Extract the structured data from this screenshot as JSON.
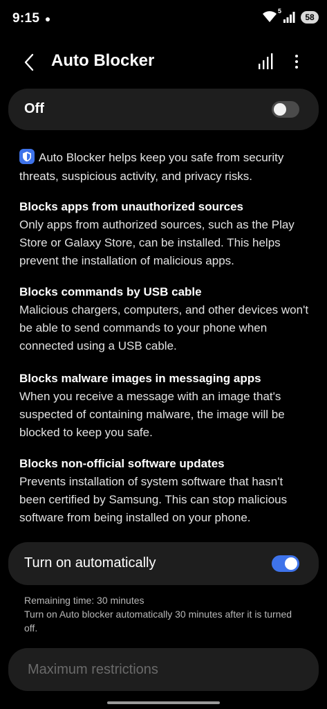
{
  "status_bar": {
    "time": "9:15",
    "wifi_badge": "5",
    "battery": "58"
  },
  "app_bar": {
    "title": "Auto Blocker"
  },
  "main_toggle": {
    "label": "Off",
    "enabled": false
  },
  "intro_text": "Auto Blocker helps keep you safe from security threats, suspicious activity, and privacy risks.",
  "sections": [
    {
      "title": "Blocks apps from unauthorized sources",
      "description": "Only apps from authorized sources, such as the Play Store or Galaxy Store, can be installed. This helps prevent the installation of malicious apps."
    },
    {
      "title": "Blocks commands by USB cable",
      "description": "Malicious chargers, computers, and other devices won't be able to send commands to your phone when connected using a USB cable."
    },
    {
      "title": "Blocks malware images in messaging apps",
      "description": "When you receive a message with an image that's suspected of containing malware, the image will be blocked to keep you safe."
    },
    {
      "title": "Blocks non-official software updates",
      "description": "Prevents installation of system software that hasn't been certified by Samsung. This can stop malicious software from being installed on your phone."
    }
  ],
  "auto_turn_on": {
    "label": "Turn on automatically",
    "enabled": true,
    "remaining_time": "Remaining time: 30 minutes",
    "description": "Turn on Auto blocker automatically 30 minutes after it is turned off."
  },
  "max_restrictions": {
    "label": "Maximum restrictions"
  },
  "colors": {
    "background": "#000000",
    "card": "#1e1e1e",
    "accent": "#3e73ea"
  }
}
